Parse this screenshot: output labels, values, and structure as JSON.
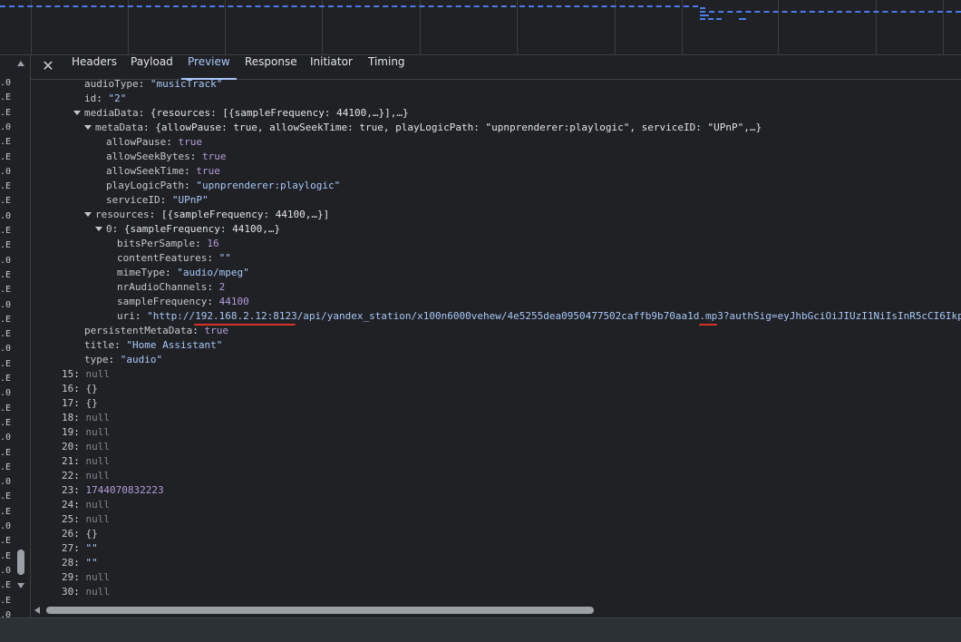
{
  "tabs": [
    {
      "label": "Headers"
    },
    {
      "label": "Payload"
    },
    {
      "label": "Preview"
    },
    {
      "label": "Response"
    },
    {
      "label": "Initiator"
    },
    {
      "label": "Timing"
    }
  ],
  "active_tab": "Preview",
  "request_list_rows": [
    "0...",
    "E...",
    "E...",
    "0...",
    "E...",
    "E...",
    "0...",
    "E...",
    "E...",
    "0...",
    "E...",
    "E...",
    "0...",
    "E...",
    "E...",
    "0...",
    "E...",
    "E...",
    "0...",
    "E...",
    "E...",
    "0...",
    "E...",
    "E...",
    "0...",
    "E...",
    "E...",
    "0...",
    "E...",
    "E...",
    "0...",
    "E...",
    "E...",
    "0...",
    "E...",
    "E...",
    "0...",
    "E..."
  ],
  "tree": {
    "audioType": {
      "key": "audioType",
      "value": "\"musicTrack\""
    },
    "id": {
      "key": "id",
      "value": "\"2\""
    },
    "mediaData": {
      "key": "mediaData",
      "summary": "{resources: [{sampleFrequency: 44100,…}],…}"
    },
    "metaData": {
      "key": "metaData",
      "summary": "{allowPause: true, allowSeekTime: true, playLogicPath: \"upnprenderer:playlogic\", serviceID: \"UPnP\",…}"
    },
    "allowPause": {
      "key": "allowPause",
      "value": "true"
    },
    "allowSeekBytes": {
      "key": "allowSeekBytes",
      "value": "true"
    },
    "allowSeekTime": {
      "key": "allowSeekTime",
      "value": "true"
    },
    "playLogicPath": {
      "key": "playLogicPath",
      "value": "\"upnprenderer:playlogic\""
    },
    "serviceID": {
      "key": "serviceID",
      "value": "\"UPnP\""
    },
    "resources": {
      "key": "resources",
      "summary": "[{sampleFrequency: 44100,…}]"
    },
    "res0": {
      "key": "0",
      "summary": "{sampleFrequency: 44100,…}"
    },
    "bitsPerSample": {
      "key": "bitsPerSample",
      "value": "16"
    },
    "contentFeatures": {
      "key": "contentFeatures",
      "value": "\"\""
    },
    "mimeType": {
      "key": "mimeType",
      "value": "\"audio/mpeg\""
    },
    "nrAudioChannels": {
      "key": "nrAudioChannels",
      "value": "2"
    },
    "sampleFrequency": {
      "key": "sampleFrequency",
      "value": "44100"
    },
    "uri": {
      "key": "uri",
      "value": "\"http://192.168.2.12:8123/api/yandex_station/x100n6000vehew/4e5255dea0950477502caffb9b70aa1d.mp3?authSig=eyJhbGciOiJIUzI1NiIsInR5cCI6Ikp"
    },
    "persistentMetaData": {
      "key": "persistentMetaData",
      "value": "true"
    },
    "title": {
      "key": "title",
      "value": "\"Home Assistant\""
    },
    "type": {
      "key": "type",
      "value": "\"audio\""
    }
  },
  "array_items": [
    {
      "index": "15",
      "value": "null",
      "kind": "nul"
    },
    {
      "index": "16",
      "value": "{}",
      "kind": "obj"
    },
    {
      "index": "17",
      "value": "{}",
      "kind": "obj"
    },
    {
      "index": "18",
      "value": "null",
      "kind": "nul"
    },
    {
      "index": "19",
      "value": "null",
      "kind": "nul"
    },
    {
      "index": "20",
      "value": "null",
      "kind": "nul"
    },
    {
      "index": "21",
      "value": "null",
      "kind": "nul"
    },
    {
      "index": "22",
      "value": "null",
      "kind": "nul"
    },
    {
      "index": "23",
      "value": "1744070832223",
      "kind": "num"
    },
    {
      "index": "24",
      "value": "null",
      "kind": "nul"
    },
    {
      "index": "25",
      "value": "null",
      "kind": "nul"
    },
    {
      "index": "26",
      "value": "{}",
      "kind": "obj"
    },
    {
      "index": "27",
      "value": "\"\"",
      "kind": "str"
    },
    {
      "index": "28",
      "value": "\"\"",
      "kind": "str"
    },
    {
      "index": "29",
      "value": "null",
      "kind": "nul"
    },
    {
      "index": "30",
      "value": "null",
      "kind": "nul"
    }
  ],
  "colors": {
    "background": "#202124",
    "string": "#a8c7fa",
    "number": "#b39ddb",
    "null": "#80868b",
    "active_tab": "#a8c7fa",
    "annotation": "#d93025"
  },
  "icons": [
    "close-icon",
    "expand-triangle-icon",
    "scroll-up-icon",
    "scroll-down-icon",
    "scroll-left-icon"
  ]
}
